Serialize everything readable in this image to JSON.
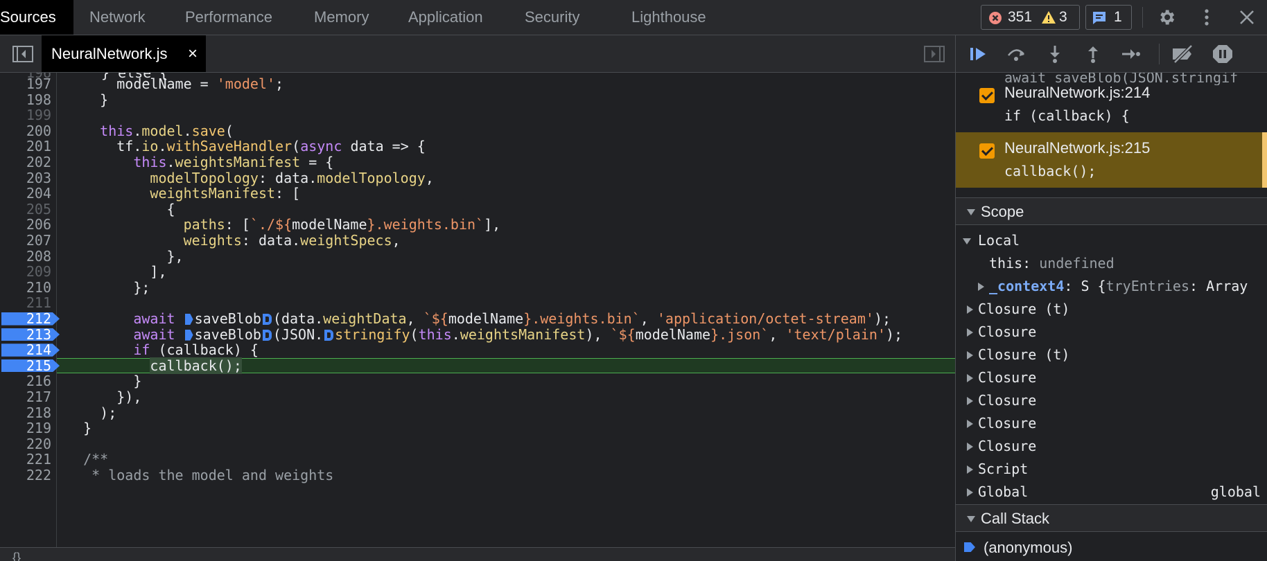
{
  "top_tabs": [
    {
      "label": "Sources",
      "active": true
    },
    {
      "label": "Network"
    },
    {
      "label": "Performance"
    },
    {
      "label": "Memory"
    },
    {
      "label": "Application"
    },
    {
      "label": "Security"
    },
    {
      "label": "Lighthouse"
    }
  ],
  "counters": {
    "errors": "351",
    "warnings": "3",
    "messages": "1"
  },
  "colors": {
    "accent": "#4285f4",
    "error": "#f28b82",
    "warning": "#fdd663",
    "paused_line": "#1f3a22",
    "hit_breakpoint": "#6b5614"
  },
  "file_tab": {
    "name": "NeuralNetwork.js",
    "close": "×"
  },
  "editor": {
    "partial_top": "} else {",
    "lines": [
      {
        "n": "197",
        "html": "      modelName = <span class=\"str\">'model'</span>;"
      },
      {
        "n": "198",
        "html": "    }"
      },
      {
        "n": "199",
        "html": ""
      },
      {
        "n": "200",
        "html": "    <span class=\"kw\">this</span>.<span class=\"pr\">model</span>.<span class=\"fn\">save</span>("
      },
      {
        "n": "201",
        "html": "      tf.<span class=\"pr\">io</span>.<span class=\"fn\">withSaveHandler</span>(<span class=\"kw\">async</span> data =&gt; {"
      },
      {
        "n": "202",
        "html": "        <span class=\"kw\">this</span>.<span class=\"pr\">weightsManifest</span> = {"
      },
      {
        "n": "203",
        "html": "          <span class=\"pr\">modelTopology</span>: data.<span class=\"pr\">modelTopology</span>,"
      },
      {
        "n": "204",
        "html": "          <span class=\"pr\">weightsManifest</span>: ["
      },
      {
        "n": "205",
        "html": "            {"
      },
      {
        "n": "206",
        "html": "              <span class=\"pr\">paths</span>: [<span class=\"tpl\">`./${</span>modelName<span class=\"tpl\">}.weights.bin`</span>],"
      },
      {
        "n": "207",
        "html": "              <span class=\"pr\">weights</span>: data.<span class=\"pr\">weightSpecs</span>,"
      },
      {
        "n": "208",
        "html": "            },"
      },
      {
        "n": "209",
        "html": "          ],"
      },
      {
        "n": "210",
        "html": "        };"
      },
      {
        "n": "211",
        "html": ""
      },
      {
        "n": "212",
        "bp": true,
        "html": "        <span class=\"kw\">await</span> <span class=\"mk solid\"></span>saveBlob<span class=\"mk hollow\"></span>(data.<span class=\"pr\">weightData</span>, <span class=\"tpl\">`${</span>modelName<span class=\"tpl\">}.weights.bin`</span>, <span class=\"str\">'application/octet-stream'</span>);"
      },
      {
        "n": "213",
        "bp": true,
        "html": "        <span class=\"kw\">await</span> <span class=\"mk solid\"></span>saveBlob<span class=\"mk hollow\"></span>(JSON.<span class=\"mk hollow\"></span><span class=\"fn\">stringify</span>(<span class=\"kw\">this</span>.<span class=\"pr\">weightsManifest</span>), <span class=\"tpl\">`${</span>modelName<span class=\"tpl\">}.json`</span>, <span class=\"str\">'text/plain'</span>);"
      },
      {
        "n": "214",
        "bp": true,
        "html": "        <span class=\"kw\">if</span> (callback) {"
      },
      {
        "n": "215",
        "bp": true,
        "exec": true,
        "html": "          <span class=\"callhl\">callback();</span>"
      },
      {
        "n": "216",
        "html": "        }"
      },
      {
        "n": "217",
        "html": "      }),"
      },
      {
        "n": "218",
        "html": "    );"
      },
      {
        "n": "219",
        "html": "  }"
      },
      {
        "n": "220",
        "html": ""
      },
      {
        "n": "221",
        "html": "  <span class=\"cm\">/**</span>"
      },
      {
        "n": "222",
        "html": "   <span class=\"cm\">* loads the model and weights</span>"
      }
    ]
  },
  "sidebar": {
    "bp_cut_text": "await saveBlob(JSON.stringif",
    "breakpoints": [
      {
        "location": "NeuralNetwork.js:214",
        "code": "if (callback) {",
        "hit": false
      },
      {
        "location": "NeuralNetwork.js:215",
        "code": "callback();",
        "hit": true
      }
    ],
    "scope_title": "Scope",
    "local_title": "Local",
    "local_this_key": "this",
    "local_this_val": "undefined",
    "context_key": "_context4",
    "context_val": "S {",
    "context_tail_key": "tryEntries",
    "context_tail_val": "Array",
    "closures": [
      "Closure (t)",
      "Closure",
      "Closure (t)",
      "Closure",
      "Closure",
      "Closure",
      "Closure"
    ],
    "script_label": "Script",
    "global_label": "Global",
    "global_value": "global",
    "callstack_title": "Call Stack",
    "callstack_top": "(anonymous)"
  }
}
